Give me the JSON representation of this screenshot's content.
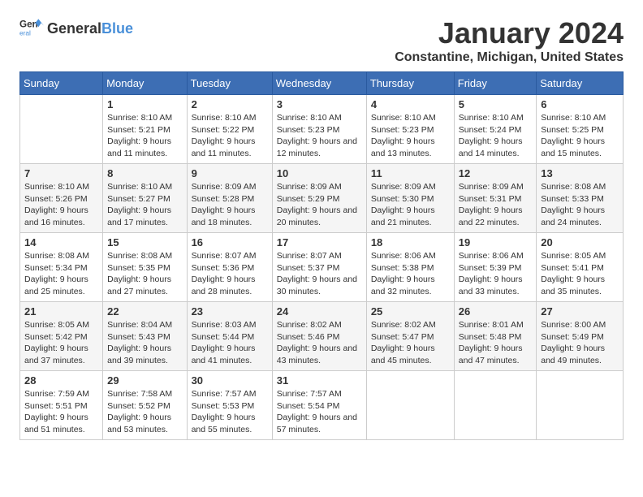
{
  "header": {
    "logo_general": "General",
    "logo_blue": "Blue",
    "month": "January 2024",
    "location": "Constantine, Michigan, United States"
  },
  "weekdays": [
    "Sunday",
    "Monday",
    "Tuesday",
    "Wednesday",
    "Thursday",
    "Friday",
    "Saturday"
  ],
  "weeks": [
    [
      {
        "day": "",
        "sunrise": "",
        "sunset": "",
        "daylight": ""
      },
      {
        "day": "1",
        "sunrise": "Sunrise: 8:10 AM",
        "sunset": "Sunset: 5:21 PM",
        "daylight": "Daylight: 9 hours and 11 minutes."
      },
      {
        "day": "2",
        "sunrise": "Sunrise: 8:10 AM",
        "sunset": "Sunset: 5:22 PM",
        "daylight": "Daylight: 9 hours and 11 minutes."
      },
      {
        "day": "3",
        "sunrise": "Sunrise: 8:10 AM",
        "sunset": "Sunset: 5:23 PM",
        "daylight": "Daylight: 9 hours and 12 minutes."
      },
      {
        "day": "4",
        "sunrise": "Sunrise: 8:10 AM",
        "sunset": "Sunset: 5:23 PM",
        "daylight": "Daylight: 9 hours and 13 minutes."
      },
      {
        "day": "5",
        "sunrise": "Sunrise: 8:10 AM",
        "sunset": "Sunset: 5:24 PM",
        "daylight": "Daylight: 9 hours and 14 minutes."
      },
      {
        "day": "6",
        "sunrise": "Sunrise: 8:10 AM",
        "sunset": "Sunset: 5:25 PM",
        "daylight": "Daylight: 9 hours and 15 minutes."
      }
    ],
    [
      {
        "day": "7",
        "sunrise": "Sunrise: 8:10 AM",
        "sunset": "Sunset: 5:26 PM",
        "daylight": "Daylight: 9 hours and 16 minutes."
      },
      {
        "day": "8",
        "sunrise": "Sunrise: 8:10 AM",
        "sunset": "Sunset: 5:27 PM",
        "daylight": "Daylight: 9 hours and 17 minutes."
      },
      {
        "day": "9",
        "sunrise": "Sunrise: 8:09 AM",
        "sunset": "Sunset: 5:28 PM",
        "daylight": "Daylight: 9 hours and 18 minutes."
      },
      {
        "day": "10",
        "sunrise": "Sunrise: 8:09 AM",
        "sunset": "Sunset: 5:29 PM",
        "daylight": "Daylight: 9 hours and 20 minutes."
      },
      {
        "day": "11",
        "sunrise": "Sunrise: 8:09 AM",
        "sunset": "Sunset: 5:30 PM",
        "daylight": "Daylight: 9 hours and 21 minutes."
      },
      {
        "day": "12",
        "sunrise": "Sunrise: 8:09 AM",
        "sunset": "Sunset: 5:31 PM",
        "daylight": "Daylight: 9 hours and 22 minutes."
      },
      {
        "day": "13",
        "sunrise": "Sunrise: 8:08 AM",
        "sunset": "Sunset: 5:33 PM",
        "daylight": "Daylight: 9 hours and 24 minutes."
      }
    ],
    [
      {
        "day": "14",
        "sunrise": "Sunrise: 8:08 AM",
        "sunset": "Sunset: 5:34 PM",
        "daylight": "Daylight: 9 hours and 25 minutes."
      },
      {
        "day": "15",
        "sunrise": "Sunrise: 8:08 AM",
        "sunset": "Sunset: 5:35 PM",
        "daylight": "Daylight: 9 hours and 27 minutes."
      },
      {
        "day": "16",
        "sunrise": "Sunrise: 8:07 AM",
        "sunset": "Sunset: 5:36 PM",
        "daylight": "Daylight: 9 hours and 28 minutes."
      },
      {
        "day": "17",
        "sunrise": "Sunrise: 8:07 AM",
        "sunset": "Sunset: 5:37 PM",
        "daylight": "Daylight: 9 hours and 30 minutes."
      },
      {
        "day": "18",
        "sunrise": "Sunrise: 8:06 AM",
        "sunset": "Sunset: 5:38 PM",
        "daylight": "Daylight: 9 hours and 32 minutes."
      },
      {
        "day": "19",
        "sunrise": "Sunrise: 8:06 AM",
        "sunset": "Sunset: 5:39 PM",
        "daylight": "Daylight: 9 hours and 33 minutes."
      },
      {
        "day": "20",
        "sunrise": "Sunrise: 8:05 AM",
        "sunset": "Sunset: 5:41 PM",
        "daylight": "Daylight: 9 hours and 35 minutes."
      }
    ],
    [
      {
        "day": "21",
        "sunrise": "Sunrise: 8:05 AM",
        "sunset": "Sunset: 5:42 PM",
        "daylight": "Daylight: 9 hours and 37 minutes."
      },
      {
        "day": "22",
        "sunrise": "Sunrise: 8:04 AM",
        "sunset": "Sunset: 5:43 PM",
        "daylight": "Daylight: 9 hours and 39 minutes."
      },
      {
        "day": "23",
        "sunrise": "Sunrise: 8:03 AM",
        "sunset": "Sunset: 5:44 PM",
        "daylight": "Daylight: 9 hours and 41 minutes."
      },
      {
        "day": "24",
        "sunrise": "Sunrise: 8:02 AM",
        "sunset": "Sunset: 5:46 PM",
        "daylight": "Daylight: 9 hours and 43 minutes."
      },
      {
        "day": "25",
        "sunrise": "Sunrise: 8:02 AM",
        "sunset": "Sunset: 5:47 PM",
        "daylight": "Daylight: 9 hours and 45 minutes."
      },
      {
        "day": "26",
        "sunrise": "Sunrise: 8:01 AM",
        "sunset": "Sunset: 5:48 PM",
        "daylight": "Daylight: 9 hours and 47 minutes."
      },
      {
        "day": "27",
        "sunrise": "Sunrise: 8:00 AM",
        "sunset": "Sunset: 5:49 PM",
        "daylight": "Daylight: 9 hours and 49 minutes."
      }
    ],
    [
      {
        "day": "28",
        "sunrise": "Sunrise: 7:59 AM",
        "sunset": "Sunset: 5:51 PM",
        "daylight": "Daylight: 9 hours and 51 minutes."
      },
      {
        "day": "29",
        "sunrise": "Sunrise: 7:58 AM",
        "sunset": "Sunset: 5:52 PM",
        "daylight": "Daylight: 9 hours and 53 minutes."
      },
      {
        "day": "30",
        "sunrise": "Sunrise: 7:57 AM",
        "sunset": "Sunset: 5:53 PM",
        "daylight": "Daylight: 9 hours and 55 minutes."
      },
      {
        "day": "31",
        "sunrise": "Sunrise: 7:57 AM",
        "sunset": "Sunset: 5:54 PM",
        "daylight": "Daylight: 9 hours and 57 minutes."
      },
      {
        "day": "",
        "sunrise": "",
        "sunset": "",
        "daylight": ""
      },
      {
        "day": "",
        "sunrise": "",
        "sunset": "",
        "daylight": ""
      },
      {
        "day": "",
        "sunrise": "",
        "sunset": "",
        "daylight": ""
      }
    ]
  ]
}
